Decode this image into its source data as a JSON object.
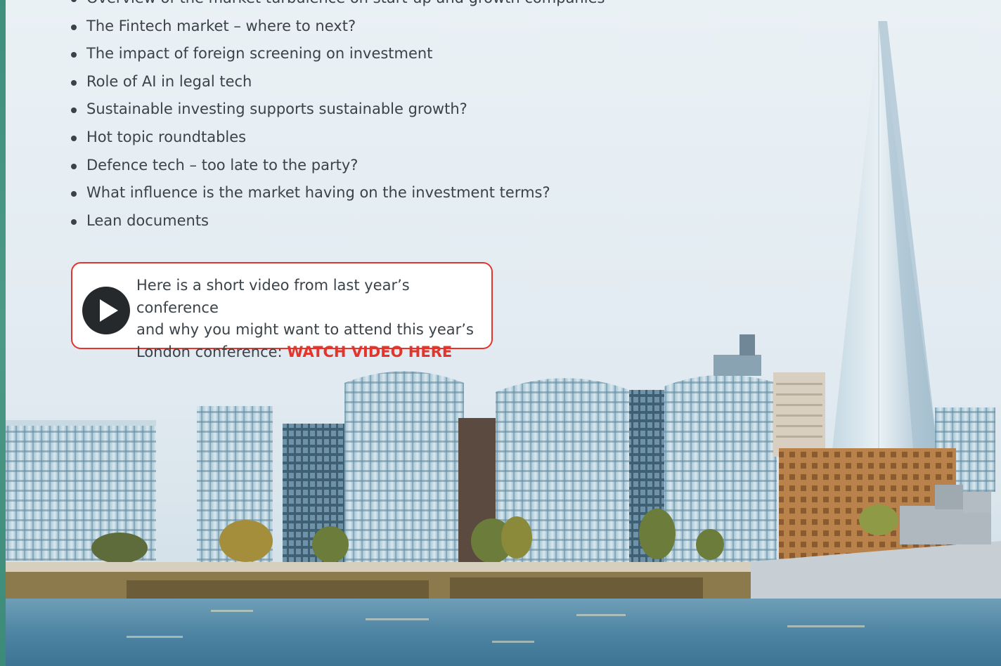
{
  "topics": [
    "Overview of the market turbulence on start-up and growth companies",
    "The Fintech market – where to next?",
    "The impact of foreign screening on investment",
    "Role of AI in legal tech",
    "Sustainable investing supports sustainable growth?",
    "Hot topic roundtables",
    "Defence tech – too late to the party?",
    "What influence is the market having on the investment terms?",
    "Lean documents"
  ],
  "video_callout": {
    "line1": "Here is a short video from last year’s conference",
    "line2": "and why you might want to attend this year’s",
    "line3": "London conference: ",
    "link_label": "WATCH VIDEO HERE",
    "icon": "play-icon"
  },
  "colors": {
    "accent_red": "#e2352b",
    "body_text": "#3b4349",
    "strip_green": "#4c9a86"
  }
}
